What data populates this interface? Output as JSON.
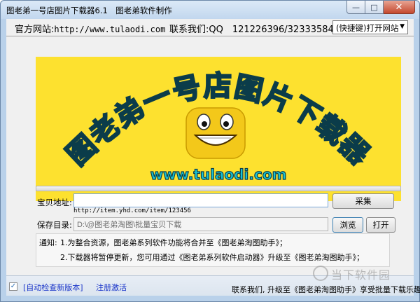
{
  "window": {
    "title": "图老弟一号店图片下载器6.1　图老弟软件制作"
  },
  "header": {
    "site_label": "官方网站:",
    "site_url": "http://www.tulaodi.com",
    "contact_text": "联系我们:QQ　121226396/32333584",
    "quick_select_value": "(快捷键)打开网站"
  },
  "banner": {
    "title": "图老弟一号店图片下载器",
    "url": "www.tulaodi.com"
  },
  "form": {
    "item_url_label": "宝贝地址:",
    "item_url_value": "",
    "collect_button": "采集",
    "example_url": "http://item.yhd.com/item/123456",
    "save_dir_label": "保存目录:",
    "save_dir_value": "D:\\@图老弟淘图\\批量宝贝下载",
    "browse_button": "浏览",
    "open_button": "打开"
  },
  "notice": {
    "label": "通知:",
    "lines": [
      "1.为整合资源，图老弟系列软件功能将合并至《图老弟淘图助手》；",
      "2.下载器将暂停更新，您可用通过《图老弟系列软件启动器》升级至《图老弟淘图助手》；"
    ]
  },
  "statusbar": {
    "auto_check_checked": true,
    "auto_check_label": "[自动检查新版本]",
    "register_link": "注册激活",
    "marquee": "联系我们, 升级至《图老弟淘图助手》享受批量下载乐趣"
  },
  "watermark": {
    "text": "当下软件园"
  },
  "colors": {
    "banner_bg": "#fde12f",
    "banner_text_fill": "#18c3d3",
    "link_blue": "#1a35c9"
  }
}
